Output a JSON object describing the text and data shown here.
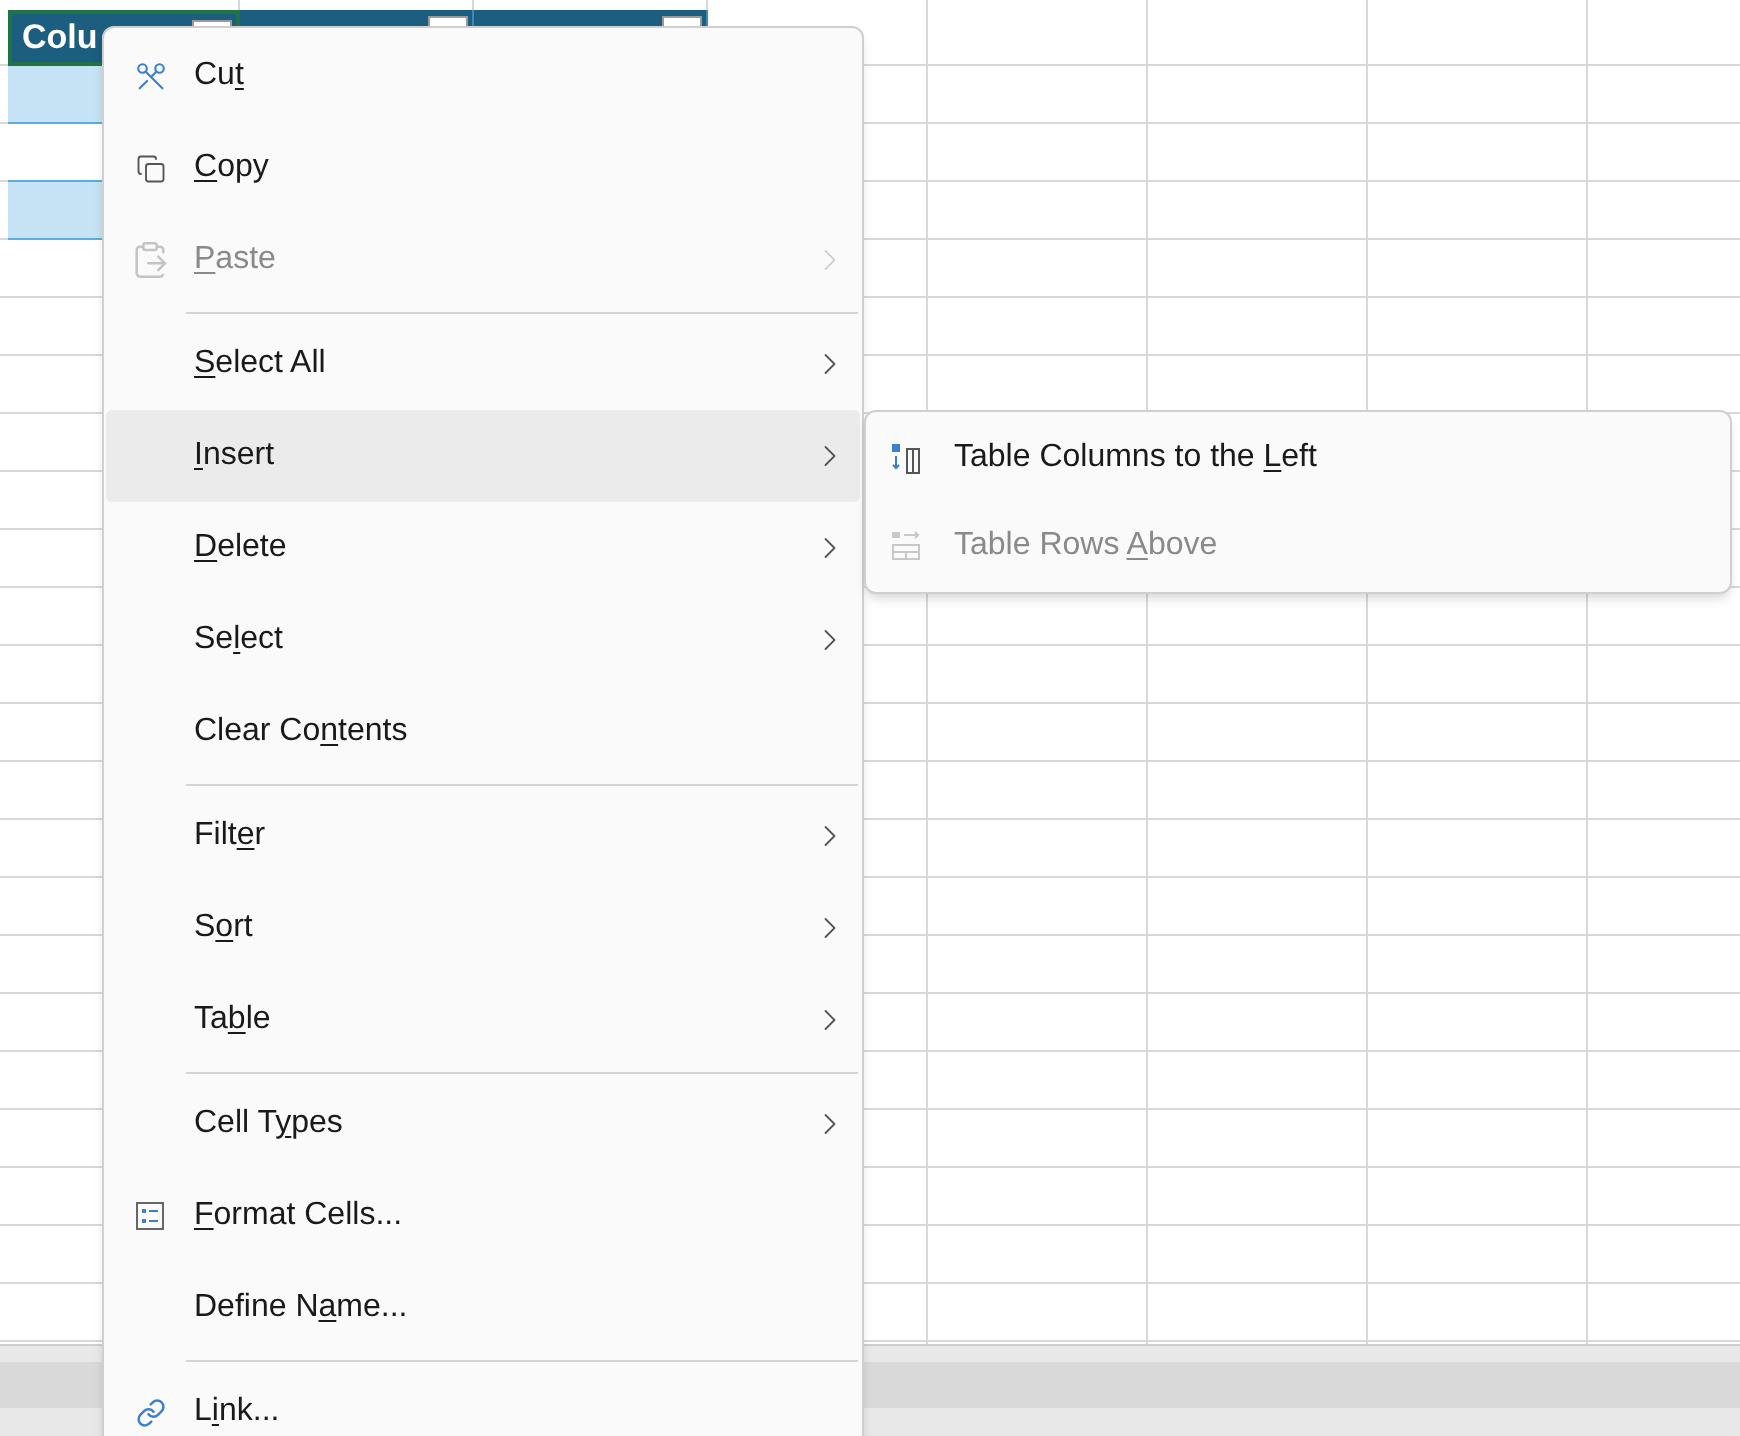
{
  "table": {
    "header_text": "Colu",
    "rows": [
      {
        "banded": true
      },
      {
        "banded": false
      },
      {
        "banded": true
      }
    ]
  },
  "context_menu": {
    "groups": [
      [
        {
          "label": {
            "before": "Cu",
            "key": "t"
          },
          "disabled": false,
          "selected": false,
          "submenu": false
        },
        {
          "label": {
            "key": "C",
            "after": "opy"
          },
          "disabled": false,
          "selected": false,
          "submenu": false
        },
        {
          "label": {
            "key": "P",
            "after": "aste"
          },
          "disabled": true,
          "selected": false,
          "submenu": true
        }
      ],
      [
        {
          "label": {
            "key": "S",
            "after": "elect All"
          },
          "disabled": false,
          "selected": false,
          "submenu": true
        },
        {
          "label": {
            "key": "I",
            "after": "nsert"
          },
          "disabled": false,
          "selected": true,
          "submenu": true
        },
        {
          "label": {
            "key": "D",
            "after": "elete"
          },
          "disabled": false,
          "selected": false,
          "submenu": true
        },
        {
          "label": {
            "before": "Se",
            "key": "l",
            "after": "ect"
          },
          "disabled": false,
          "selected": false,
          "submenu": true
        },
        {
          "label": {
            "before": "Clear Co",
            "key": "n",
            "after": "tents"
          },
          "disabled": false,
          "selected": false,
          "submenu": false
        }
      ],
      [
        {
          "label": {
            "before": "Filt",
            "key": "e",
            "after": "r"
          },
          "disabled": false,
          "selected": false,
          "submenu": true
        },
        {
          "label": {
            "before": "S",
            "key": "o",
            "after": "rt"
          },
          "disabled": false,
          "selected": false,
          "submenu": true
        },
        {
          "label": {
            "before": "Ta",
            "key": "b",
            "after": "le"
          },
          "disabled": false,
          "selected": false,
          "submenu": true
        }
      ],
      [
        {
          "label": {
            "before": "Cell T",
            "key": "y",
            "after": "pes"
          },
          "disabled": false,
          "selected": false,
          "submenu": true
        },
        {
          "label": {
            "key": "F",
            "after": "ormat Cells..."
          },
          "disabled": false,
          "selected": false,
          "submenu": false
        },
        {
          "label": {
            "before": "Define N",
            "key": "a",
            "after": "me..."
          },
          "disabled": false,
          "selected": false,
          "submenu": false
        }
      ],
      [
        {
          "label": {
            "before": "L",
            "key": "i",
            "after": "nk..."
          },
          "disabled": false,
          "selected": false,
          "submenu": false
        }
      ]
    ]
  },
  "submenu": {
    "items": [
      {
        "label": {
          "before": "Table Columns to the ",
          "key": "L",
          "after": "eft"
        },
        "disabled": false
      },
      {
        "label": {
          "before": "Table Rows ",
          "key": "A",
          "after": "bove"
        },
        "disabled": true
      }
    ]
  }
}
